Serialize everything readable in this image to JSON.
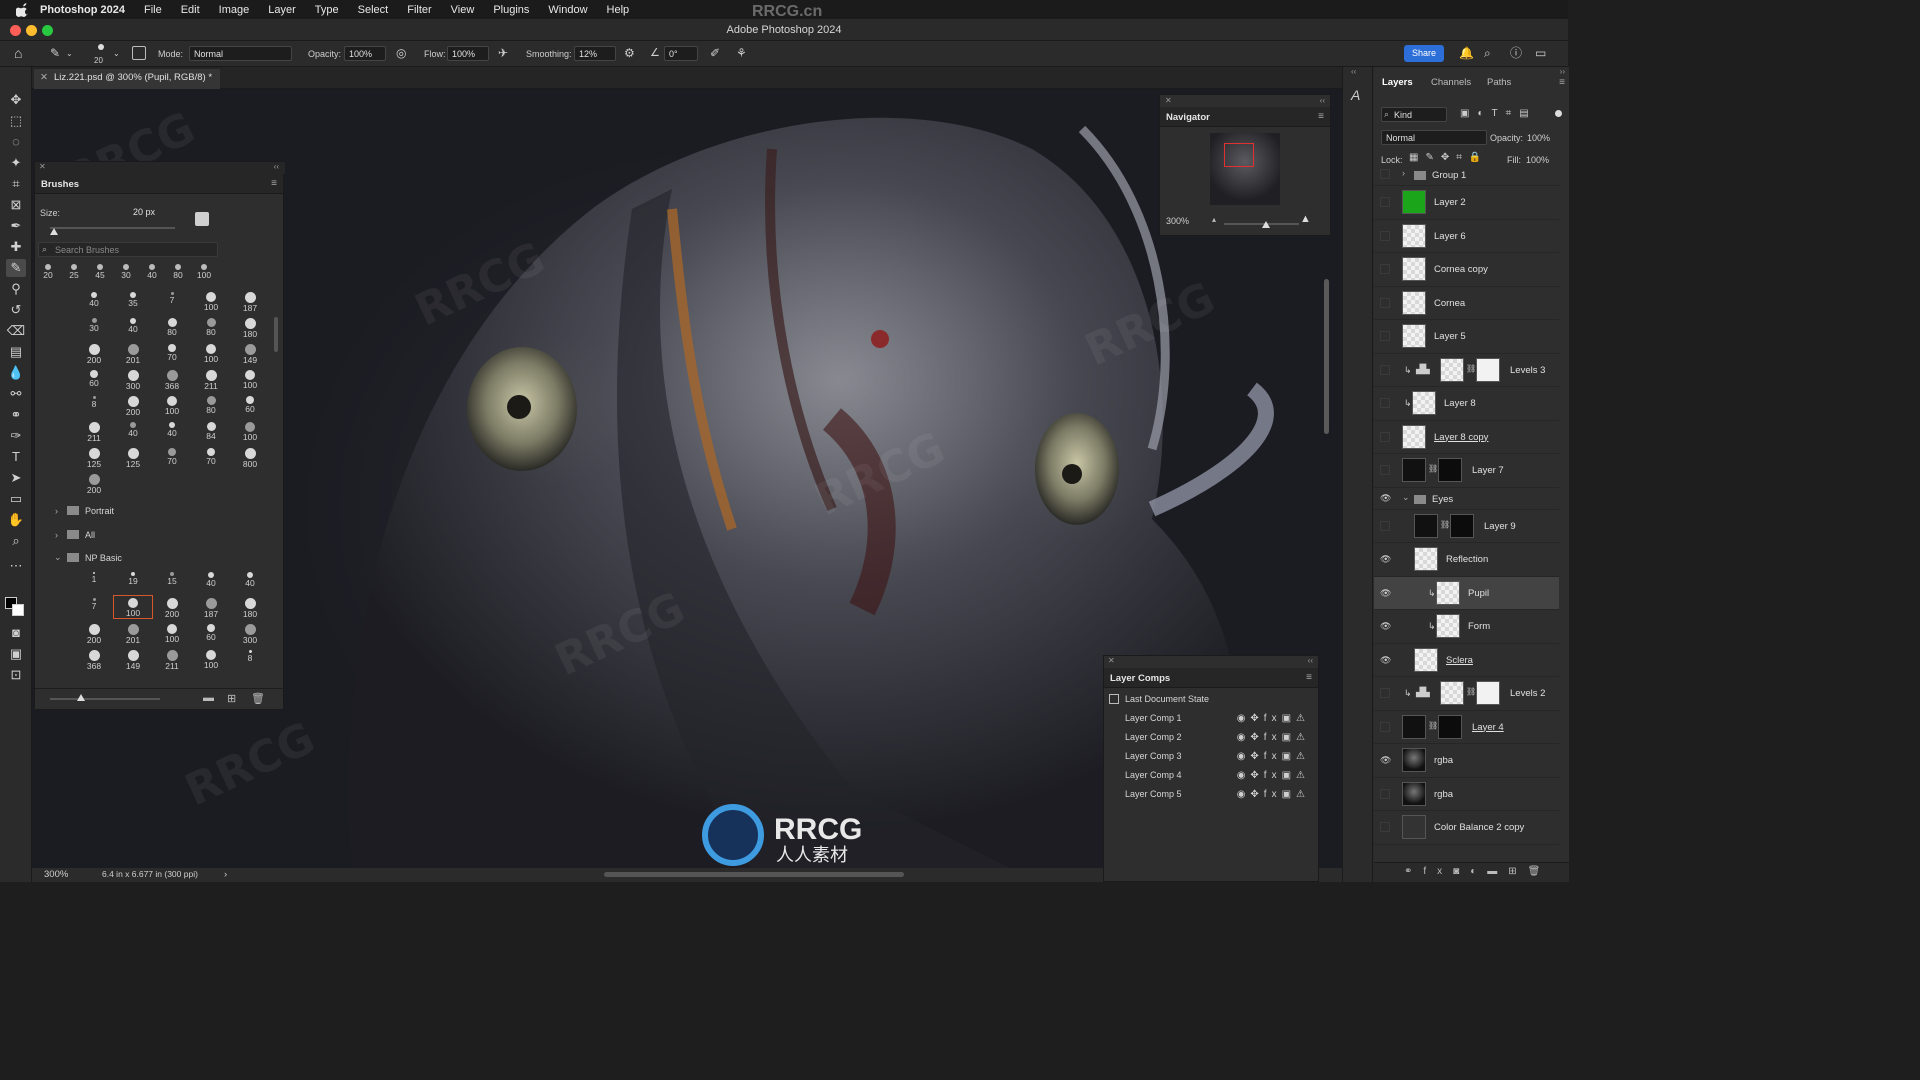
{
  "menubar": {
    "app_name": "Photoshop 2024",
    "items": [
      "File",
      "Edit",
      "Image",
      "Layer",
      "Type",
      "Select",
      "Filter",
      "View",
      "Plugins",
      "Window",
      "Help"
    ]
  },
  "window": {
    "title": "Adobe Photoshop 2024",
    "watermark": "RRCG.cn"
  },
  "options": {
    "brush_size": "20",
    "mode_label": "Mode:",
    "mode_value": "Normal",
    "opacity_label": "Opacity:",
    "opacity_value": "100%",
    "flow_label": "Flow:",
    "flow_value": "100%",
    "smoothing_label": "Smoothing:",
    "smoothing_value": "12%",
    "angle_value": "0°",
    "share_label": "Share"
  },
  "document": {
    "tab_title": "Liz.221.psd @ 300% (Pupil, RGB/8) *",
    "zoom": "300%",
    "doc_info": "6.4 in x 6.677 in (300 ppi)"
  },
  "brushes": {
    "title": "Brushes",
    "size_label": "Size:",
    "size_value": "20 px",
    "search_placeholder": "Search Brushes",
    "recent": [
      "20",
      "25",
      "45",
      "30",
      "40",
      "80",
      "100"
    ],
    "grid1": [
      "40",
      "35",
      "7",
      "100",
      "187",
      "30",
      "40",
      "80",
      "80",
      "180",
      "200",
      "201",
      "70",
      "100",
      "149",
      "60",
      "300",
      "368",
      "211",
      "100",
      "8",
      "200",
      "100",
      "80",
      "60",
      "211",
      "40",
      "40",
      "84",
      "100",
      "125",
      "125",
      "70",
      "70",
      "800",
      "200"
    ],
    "folders": [
      "Portrait",
      "All",
      "NP Basic"
    ],
    "grid2": [
      "1",
      "19",
      "15",
      "40",
      "40",
      "7",
      "100",
      "200",
      "187",
      "180",
      "200",
      "201",
      "100",
      "60",
      "300",
      "368",
      "149",
      "211",
      "100",
      "8"
    ],
    "selected_index": 6
  },
  "navigator": {
    "title": "Navigator",
    "zoom": "300%"
  },
  "layer_comps": {
    "title": "Layer Comps",
    "state": "Last Document State",
    "comps": [
      "Layer Comp 1",
      "Layer Comp 2",
      "Layer Comp 3",
      "Layer Comp 4",
      "Layer Comp 5"
    ]
  },
  "layers_panel": {
    "tabs": [
      "Layers",
      "Channels",
      "Paths"
    ],
    "filter_kind": "Kind",
    "blend_mode": "Normal",
    "opacity_label": "Opacity:",
    "opacity_value": "100%",
    "lock_label": "Lock:",
    "fill_label": "Fill:",
    "fill_value": "100%",
    "layers": [
      {
        "name": "Group 1",
        "visible": false
      },
      {
        "name": "Layer 2",
        "visible": false
      },
      {
        "name": "Layer 6",
        "visible": false
      },
      {
        "name": "Cornea copy",
        "visible": false
      },
      {
        "name": "Cornea",
        "visible": false
      },
      {
        "name": "Layer 5",
        "visible": false
      },
      {
        "name": "Levels 3",
        "visible": false
      },
      {
        "name": "Layer 8",
        "visible": false
      },
      {
        "name": "Layer 8 copy",
        "visible": false
      },
      {
        "name": "Layer 7",
        "visible": false
      },
      {
        "name": "Eyes",
        "visible": true
      },
      {
        "name": "Layer 9",
        "visible": false
      },
      {
        "name": "Reflection",
        "visible": true
      },
      {
        "name": "Pupil",
        "visible": true
      },
      {
        "name": "Form",
        "visible": true
      },
      {
        "name": "Sclera",
        "visible": true
      },
      {
        "name": "Levels 2",
        "visible": false
      },
      {
        "name": "Layer 4",
        "visible": false
      },
      {
        "name": "rgba",
        "visible": true
      },
      {
        "name": "rgba",
        "visible": false
      },
      {
        "name": "Color Balance 2 copy",
        "visible": false
      }
    ]
  },
  "overlay": {
    "logo_text": "RRCG",
    "logo_sub": "人人素材"
  }
}
